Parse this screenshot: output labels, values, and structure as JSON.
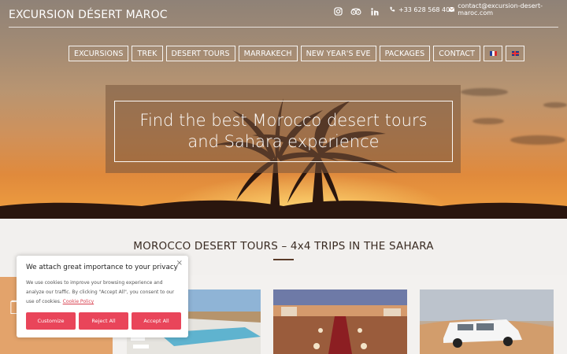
{
  "header": {
    "logo": "EXCURSION DÉSERT MAROC",
    "phone": "+33 628 568 405",
    "email": "contact@excursion-desert-maroc.com",
    "social_icons": [
      "instagram-icon",
      "tripadvisor-icon",
      "linkedin-icon"
    ]
  },
  "nav": {
    "items": [
      "EXCURSIONS",
      "TREK",
      "DESERT TOURS",
      "MARRAKECH",
      "NEW YEAR'S EVE",
      "PACKAGES",
      "CONTACT"
    ],
    "languages": [
      "fr",
      "en"
    ]
  },
  "hero": {
    "headline": "Find the best Morocco desert tours and Sahara experience"
  },
  "section": {
    "title": "MOROCCO DESERT TOURS – 4x4 TRIPS IN THE SAHARA"
  },
  "cookie": {
    "close": "×",
    "title": "We attach great importance to your privacy",
    "text": "We use cookies to improve your browsing experience and analyze our traffic. By clicking \"Accept All\", you consent to our use of cookies.",
    "policy_link": "Cookie Policy",
    "buttons": {
      "customize": "Customize",
      "reject": "Reject All",
      "accept": "Accept All"
    }
  },
  "colors": {
    "accent": "#e9455a",
    "section_title": "#3a2b22",
    "side_tab": "#e3a36b"
  }
}
